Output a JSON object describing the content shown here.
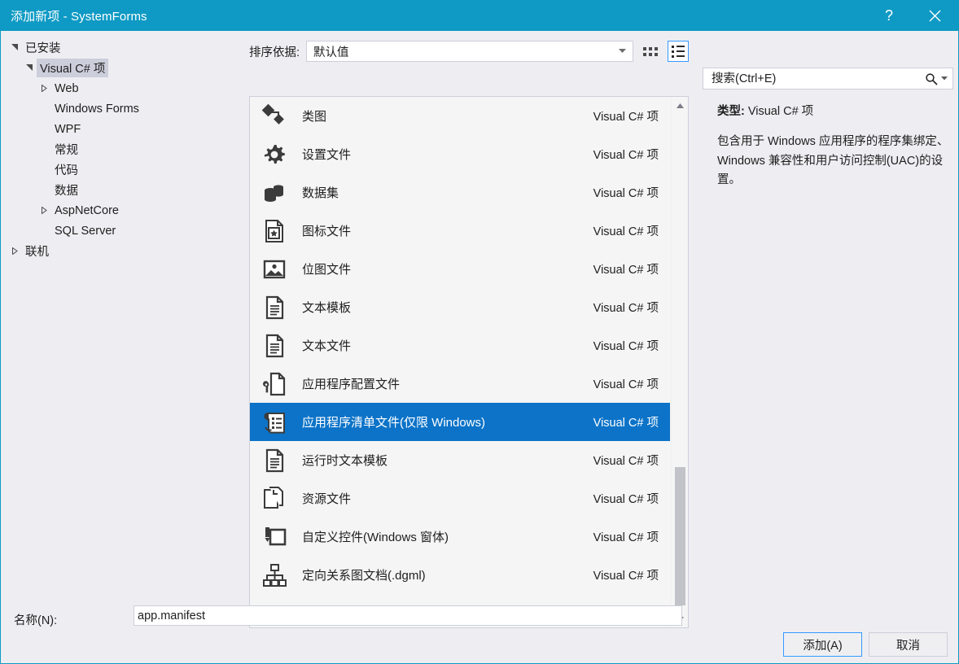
{
  "window": {
    "title": "添加新项 - SystemForms",
    "help_icon": "help-icon",
    "close_icon": "close-icon",
    "accent_color": "#0e9ac4"
  },
  "tree": {
    "nodes": [
      {
        "label": "已安装",
        "level": 0,
        "expander": "expanded",
        "selected": false
      },
      {
        "label": "Visual C# 项",
        "level": 1,
        "expander": "expanded",
        "selected": true
      },
      {
        "label": "Web",
        "level": 2,
        "expander": "collapsed",
        "selected": false
      },
      {
        "label": "Windows Forms",
        "level": 2,
        "expander": "none",
        "selected": false
      },
      {
        "label": "WPF",
        "level": 2,
        "expander": "none",
        "selected": false
      },
      {
        "label": "常规",
        "level": 2,
        "expander": "none",
        "selected": false
      },
      {
        "label": "代码",
        "level": 2,
        "expander": "none",
        "selected": false
      },
      {
        "label": "数据",
        "level": 2,
        "expander": "none",
        "selected": false
      },
      {
        "label": "AspNetCore",
        "level": 2,
        "expander": "collapsed",
        "selected": false
      },
      {
        "label": "SQL Server",
        "level": 2,
        "expander": "none",
        "selected": false
      },
      {
        "label": "联机",
        "level": 0,
        "expander": "collapsed",
        "selected": false
      }
    ]
  },
  "toolbar": {
    "sort_label": "排序依据:",
    "sort_value": "默认值",
    "grid_view_icon": "grid-view-icon",
    "list_view_icon": "list-view-icon",
    "active_view": "list"
  },
  "search": {
    "placeholder": "搜索(Ctrl+E)",
    "value": "",
    "icon": "search-icon",
    "dropdown_icon": "chevron-down-icon"
  },
  "list": {
    "items": [
      {
        "name": "类图",
        "type": "Visual C# 项",
        "icon": "class-diagram-icon",
        "selected": false
      },
      {
        "name": "设置文件",
        "type": "Visual C# 项",
        "icon": "settings-gear-icon",
        "selected": false
      },
      {
        "name": "数据集",
        "type": "Visual C# 项",
        "icon": "dataset-icon",
        "selected": false
      },
      {
        "name": "图标文件",
        "type": "Visual C# 项",
        "icon": "icon-file-icon",
        "selected": false
      },
      {
        "name": "位图文件",
        "type": "Visual C# 项",
        "icon": "bitmap-file-icon",
        "selected": false
      },
      {
        "name": "文本模板",
        "type": "Visual C# 项",
        "icon": "text-template-icon",
        "selected": false
      },
      {
        "name": "文本文件",
        "type": "Visual C# 项",
        "icon": "text-file-icon",
        "selected": false
      },
      {
        "name": "应用程序配置文件",
        "type": "Visual C# 项",
        "icon": "app-config-icon",
        "selected": false
      },
      {
        "name": "应用程序清单文件(仅限 Windows)",
        "type": "Visual C# 项",
        "icon": "app-manifest-icon",
        "selected": true
      },
      {
        "name": "运行时文本模板",
        "type": "Visual C# 项",
        "icon": "runtime-template-icon",
        "selected": false
      },
      {
        "name": "资源文件",
        "type": "Visual C# 项",
        "icon": "resource-file-icon",
        "selected": false
      },
      {
        "name": "自定义控件(Windows 窗体)",
        "type": "Visual C# 项",
        "icon": "custom-control-icon",
        "selected": false
      },
      {
        "name": "定向关系图文档(.dgml)",
        "type": "Visual C# 项",
        "icon": "dgml-graph-icon",
        "selected": false
      }
    ],
    "selected_color": "#0c73c8",
    "scrollbar": {
      "up_icon": "scroll-up-icon",
      "down_icon": "scroll-down-icon"
    }
  },
  "details": {
    "type_label": "类型:",
    "type_value": "Visual C# 项",
    "description": "包含用于 Windows 应用程序的程序集绑定、Windows 兼容性和用户访问控制(UAC)的设置。"
  },
  "bottom": {
    "name_label": "名称(N):",
    "name_value": "app.manifest",
    "add_button": "添加(A)",
    "cancel_button": "取消"
  }
}
